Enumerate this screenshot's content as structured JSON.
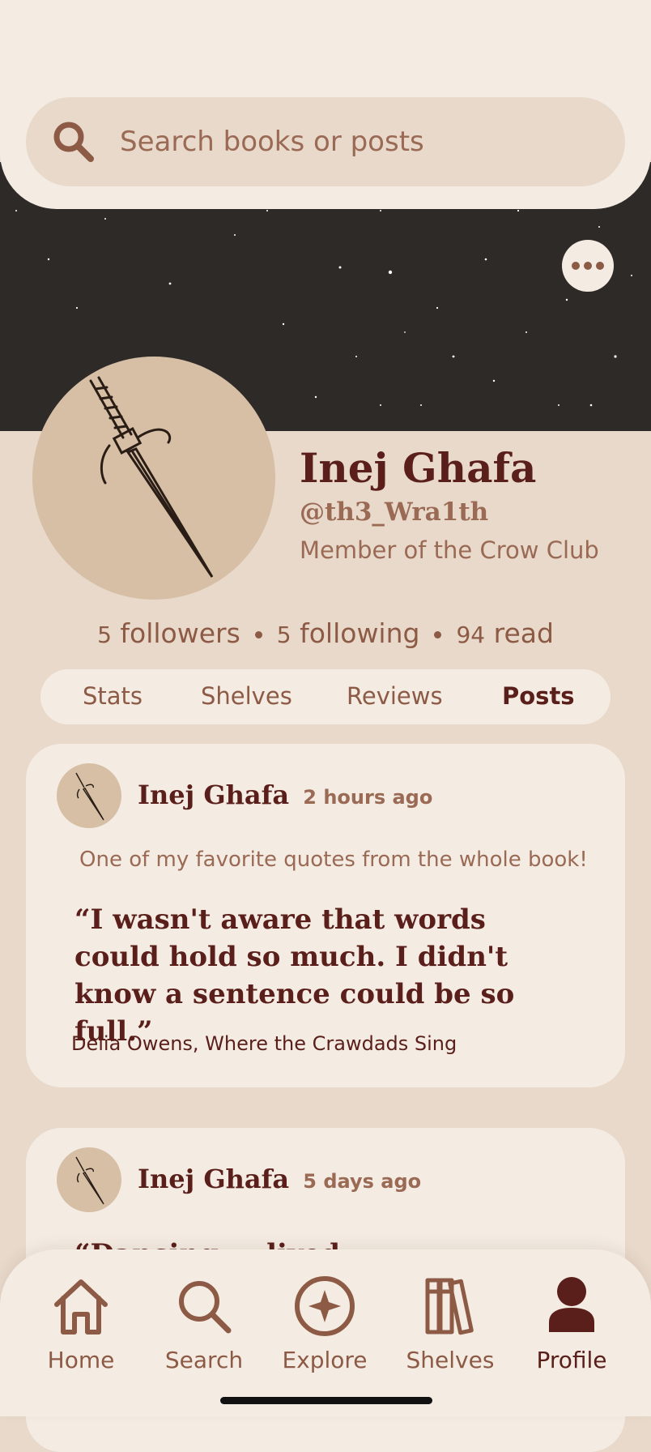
{
  "search": {
    "placeholder": "Search books or posts"
  },
  "profile": {
    "name": "Inej Ghafa",
    "handle": "@th3_Wra1th",
    "bio": "Member of the Crow Club",
    "followers_count": "5",
    "followers_label": "followers",
    "following_count": "5",
    "following_label": "following",
    "read_count": "94",
    "read_label": "read"
  },
  "tabs": [
    {
      "label": "Stats",
      "active": false
    },
    {
      "label": "Shelves",
      "active": false
    },
    {
      "label": "Reviews",
      "active": false
    },
    {
      "label": "Posts",
      "active": true
    }
  ],
  "posts": [
    {
      "author": "Inej Ghafa",
      "time": "2 hours ago",
      "caption": "One of my favorite quotes from the whole book!",
      "quote": "“I wasn't aware that words could hold so much. I didn't know a sentence could be so full.”",
      "attribution": "Delia Owens, Where the Crawdads Sing"
    },
    {
      "author": "Inej Ghafa",
      "time": "5 days ago",
      "quote_partial": "“Dancing ... lived ..."
    }
  ],
  "nav": [
    {
      "label": "Home",
      "icon": "home-icon"
    },
    {
      "label": "Search",
      "icon": "search-icon"
    },
    {
      "label": "Explore",
      "icon": "compass-icon"
    },
    {
      "label": "Shelves",
      "icon": "books-icon"
    },
    {
      "label": "Profile",
      "icon": "person-icon",
      "active": true
    }
  ],
  "colors": {
    "background": "#e8d9cb",
    "surface": "#f4ece3",
    "accent": "#8c5a45",
    "dark": "#5a1f1a",
    "banner": "#2e2a28"
  }
}
